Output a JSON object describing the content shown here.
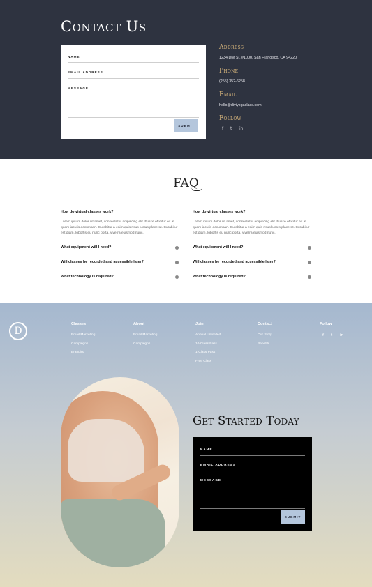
{
  "contact": {
    "title": "Contact Us",
    "form": {
      "name_label": "Name",
      "email_label": "Email Address",
      "message_label": "Message",
      "submit_label": "Submit"
    },
    "address_heading": "Address",
    "address": "1234 Divi St. #1000, San Francisco, CA 94220",
    "phone_heading": "Phone",
    "phone": "(255) 352-6258",
    "email_heading": "Email",
    "email": "hello@diviyogaclass.com",
    "follow_heading": "Follow",
    "social": [
      "f",
      "t",
      "in"
    ]
  },
  "faq": {
    "title": "FAQ",
    "left": {
      "open_question": "How do virtual classes work?",
      "open_answer": "Lorem ipsum dolor sit amet, consectetur adipiscing elit. Fusce efficitur ex at quam iaculis accumsan. Curabitur a enim quis risus luctus placerat. Curabitur est diam, lobortis eu nunc porta, viverra euismod nunc.",
      "questions": [
        "What equipment will I need?",
        "Will classes be recorded and accessible later?",
        "What technology is required?"
      ]
    },
    "right": {
      "open_question": "How do virtual classes work?",
      "open_answer": "Lorem ipsum dolor sit amet, consectetur adipiscing elit. Fusce efficitur ex at quam iaculis accumsan. Curabitur a enim quis risus luctus placerat. Curabitur est diam, lobortis eu nunc porta, viverra euismod nunc.",
      "questions": [
        "What equipment will I need?",
        "Will classes be recorded and accessible later?",
        "What technology is required?"
      ]
    }
  },
  "footer": {
    "logo_letter": "D",
    "columns": [
      {
        "heading": "Classes",
        "links": [
          "Email Marketing",
          "Campaigns",
          "Branding"
        ]
      },
      {
        "heading": "About",
        "links": [
          "Email Marketing",
          "Campaigns"
        ]
      },
      {
        "heading": "Join",
        "links": [
          "Annual Unlimited",
          "10-Class Pass",
          "1-Class Pass",
          "Free Class"
        ]
      },
      {
        "heading": "Contact",
        "links": [
          "Our Story",
          "Benefits"
        ]
      }
    ],
    "follow_heading": "Follow",
    "social": [
      "f",
      "t",
      "in"
    ]
  },
  "get_started": {
    "title": "Get Started Today",
    "form": {
      "name_label": "Name",
      "email_label": "Email Address",
      "message_label": "Message",
      "submit_label": "Submit"
    }
  },
  "colors": {
    "dark_navy": "#2e3340",
    "gold_accent": "#d9b77d",
    "button_blue": "#b4c6dc"
  }
}
